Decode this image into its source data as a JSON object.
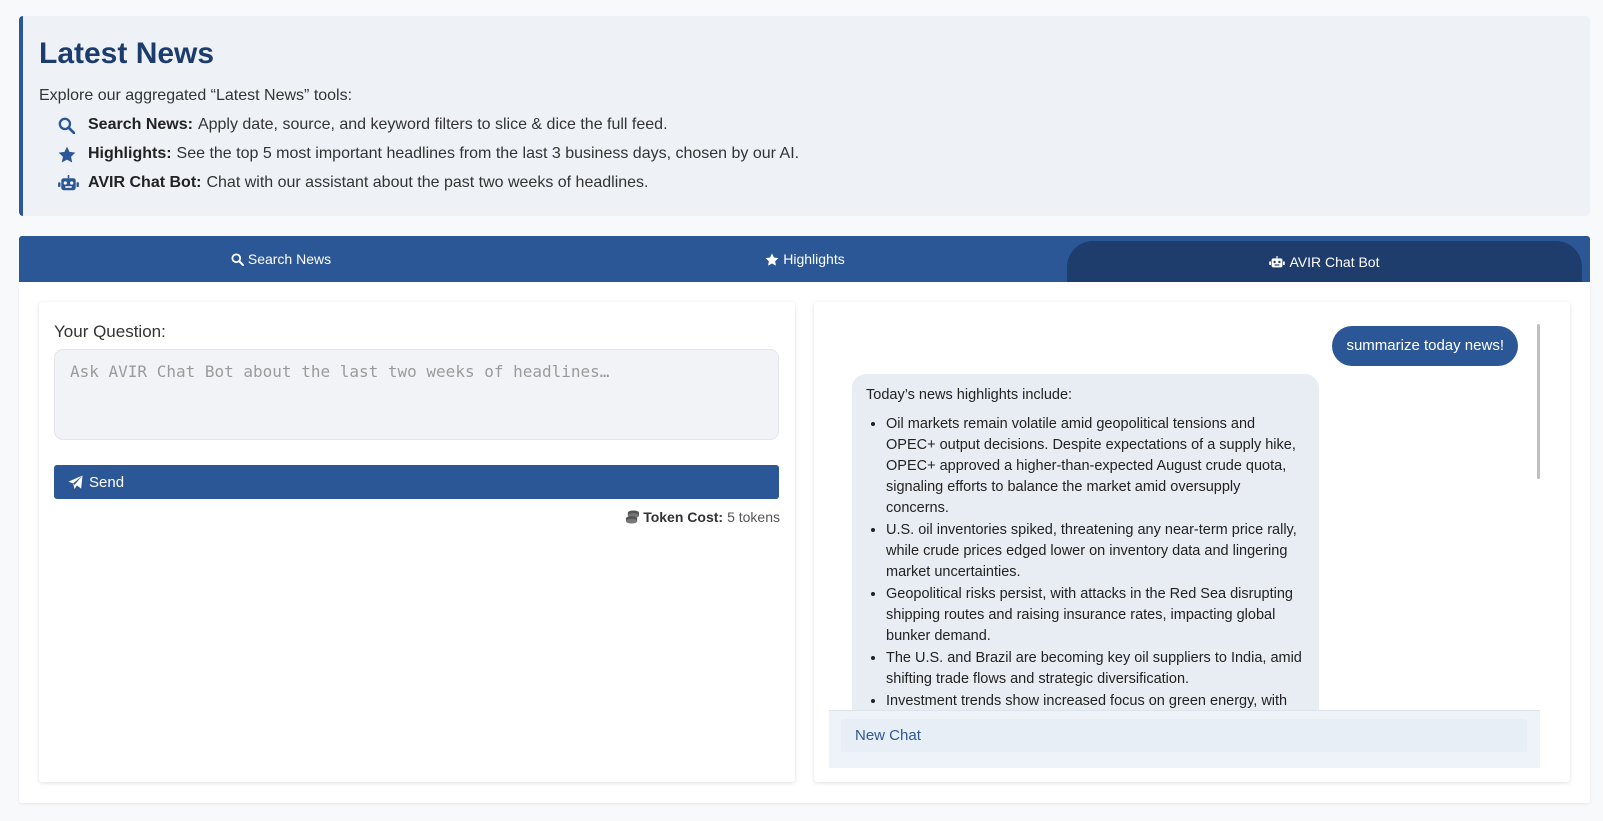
{
  "intro": {
    "title": "Latest News",
    "lead": "Explore our aggregated “Latest News” tools:",
    "items": [
      {
        "icon": "search-icon",
        "label": "Search News:",
        "text": "Apply date, source, and keyword filters to slice & dice the full feed."
      },
      {
        "icon": "star-icon",
        "label": "Highlights:",
        "text": "See the top 5 most important headlines from the last 3 business days, chosen by our AI."
      },
      {
        "icon": "robot-icon",
        "label": "AVIR Chat Bot:",
        "text": "Chat with our assistant about the past two weeks of headlines."
      }
    ]
  },
  "tabs": [
    {
      "icon": "search-icon",
      "label": "Search News",
      "active": false
    },
    {
      "icon": "star-icon",
      "label": "Highlights",
      "active": false
    },
    {
      "icon": "robot-icon",
      "label": "AVIR Chat Bot",
      "active": true
    }
  ],
  "question": {
    "label": "Your Question:",
    "placeholder": "Ask AVIR Chat Bot about the last two weeks of headlines…",
    "send_label": "Send",
    "token_label": "Token Cost:",
    "token_value": "5 tokens"
  },
  "chat": {
    "user_message": "summarize today news!",
    "bot_intro": "Today’s news highlights include:",
    "bot_points": [
      "Oil markets remain volatile amid geopolitical tensions and OPEC+ output decisions. Despite expectations of a supply hike, OPEC+ approved a higher-than-expected August crude quota, signaling efforts to balance the market amid oversupply concerns.",
      "U.S. oil inventories spiked, threatening any near-term price rally, while crude prices edged lower on inventory data and lingering market uncertainties.",
      "Geopolitical risks persist, with attacks in the Red Sea disrupting shipping routes and raising insurance rates, impacting global bunker demand.",
      "The U.S. and Brazil are becoming key oil suppliers to India, amid shifting trade flows and strategic diversification.",
      "Investment trends show increased focus on green energy, with"
    ],
    "new_chat_label": "New Chat"
  },
  "colors": {
    "primary": "#2b5797",
    "primary_dark": "#1e3d6d",
    "title": "#1c3c6e",
    "bot_bubble": "#e8edf4"
  }
}
